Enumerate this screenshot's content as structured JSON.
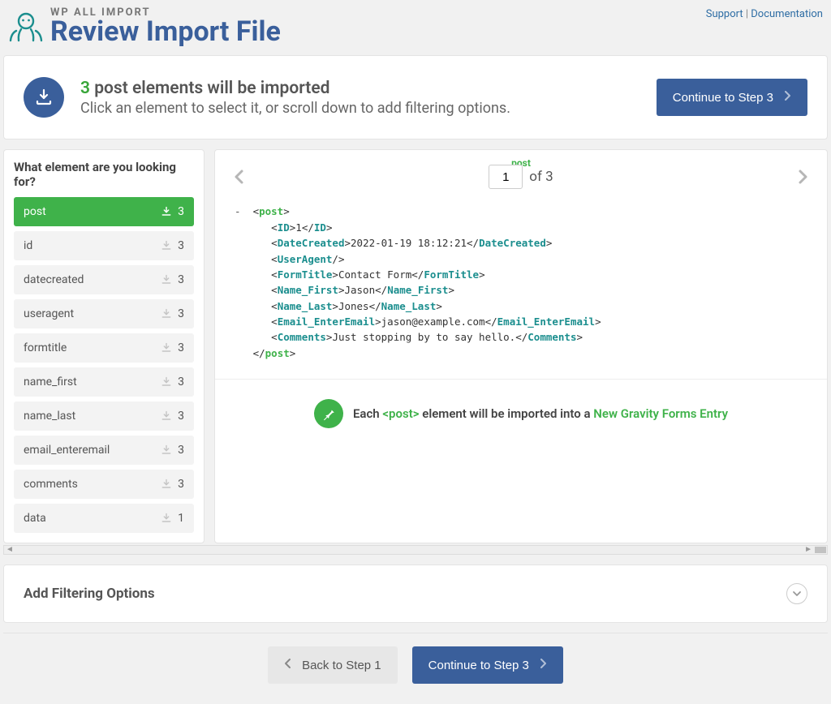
{
  "brand": {
    "sup": "WP ALL IMPORT",
    "title": "Review Import File"
  },
  "header_links": {
    "support": "Support",
    "documentation": "Documentation"
  },
  "notice": {
    "count": "3",
    "heading_rest": " post elements will be imported",
    "subtext": "Click an element to select it, or scroll down to add filtering options.",
    "continue_btn": "Continue to Step 3"
  },
  "sidebar": {
    "title": "What element are you looking for?",
    "items": [
      {
        "name": "post",
        "count": "3",
        "selected": true
      },
      {
        "name": "id",
        "count": "3",
        "selected": false
      },
      {
        "name": "datecreated",
        "count": "3",
        "selected": false
      },
      {
        "name": "useragent",
        "count": "3",
        "selected": false
      },
      {
        "name": "formtitle",
        "count": "3",
        "selected": false
      },
      {
        "name": "name_first",
        "count": "3",
        "selected": false
      },
      {
        "name": "name_last",
        "count": "3",
        "selected": false
      },
      {
        "name": "email_enteremail",
        "count": "3",
        "selected": false
      },
      {
        "name": "comments",
        "count": "3",
        "selected": false
      },
      {
        "name": "data",
        "count": "1",
        "selected": false
      }
    ]
  },
  "preview": {
    "root": "post",
    "pager": {
      "current": "1",
      "of": "of 3"
    },
    "record": {
      "ID": "1",
      "DateCreated": "2022-01-19 18:12:21",
      "UserAgent": "",
      "FormTitle": "Contact Form",
      "Name_First": "Jason",
      "Name_Last": "Jones",
      "Email_EnterEmail": "jason@example.com",
      "Comments": "Just stopping by to say hello."
    },
    "note": {
      "pre": "Each ",
      "tag": "<post>",
      "mid": " element will be imported into a ",
      "target": "New Gravity Forms Entry"
    }
  },
  "filter": {
    "title": "Add Filtering Options"
  },
  "footer": {
    "back": "Back to Step 1",
    "continue": "Continue to Step 3"
  },
  "colors": {
    "accent": "#3a5f9b",
    "green": "#3fb24a"
  }
}
